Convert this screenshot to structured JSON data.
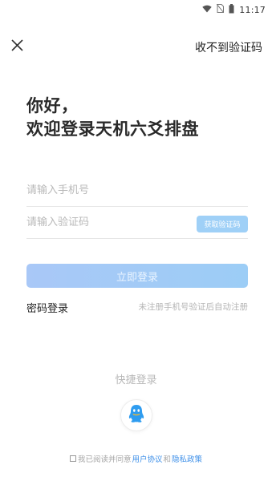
{
  "statusbar": {
    "time": "11:17",
    "icons": [
      "wifi-icon",
      "no-sim-icon",
      "battery-icon"
    ]
  },
  "header": {
    "close_icon": "close-icon",
    "no_code_label": "收不到验证码"
  },
  "greeting": {
    "line1": "你好，",
    "line2": "欢迎登录天机六爻排盘"
  },
  "form": {
    "phone_placeholder": "请输入手机号",
    "code_placeholder": "请输入验证码",
    "get_code_label": "获取验证码",
    "login_label": "立即登录"
  },
  "options": {
    "password_login": "密码登录",
    "auto_register": "未注册手机号验证后自动注册"
  },
  "quick_login": {
    "title": "快捷登录",
    "qq_icon": "qq-icon"
  },
  "agreement": {
    "prefix": "我已阅读并同意",
    "user_agreement": "用户协议",
    "and": "和",
    "privacy_policy": "隐私政策"
  },
  "colors": {
    "accent": "#9fd0f7",
    "link": "#3b8ee8",
    "login_button": "#a9c8f7"
  }
}
